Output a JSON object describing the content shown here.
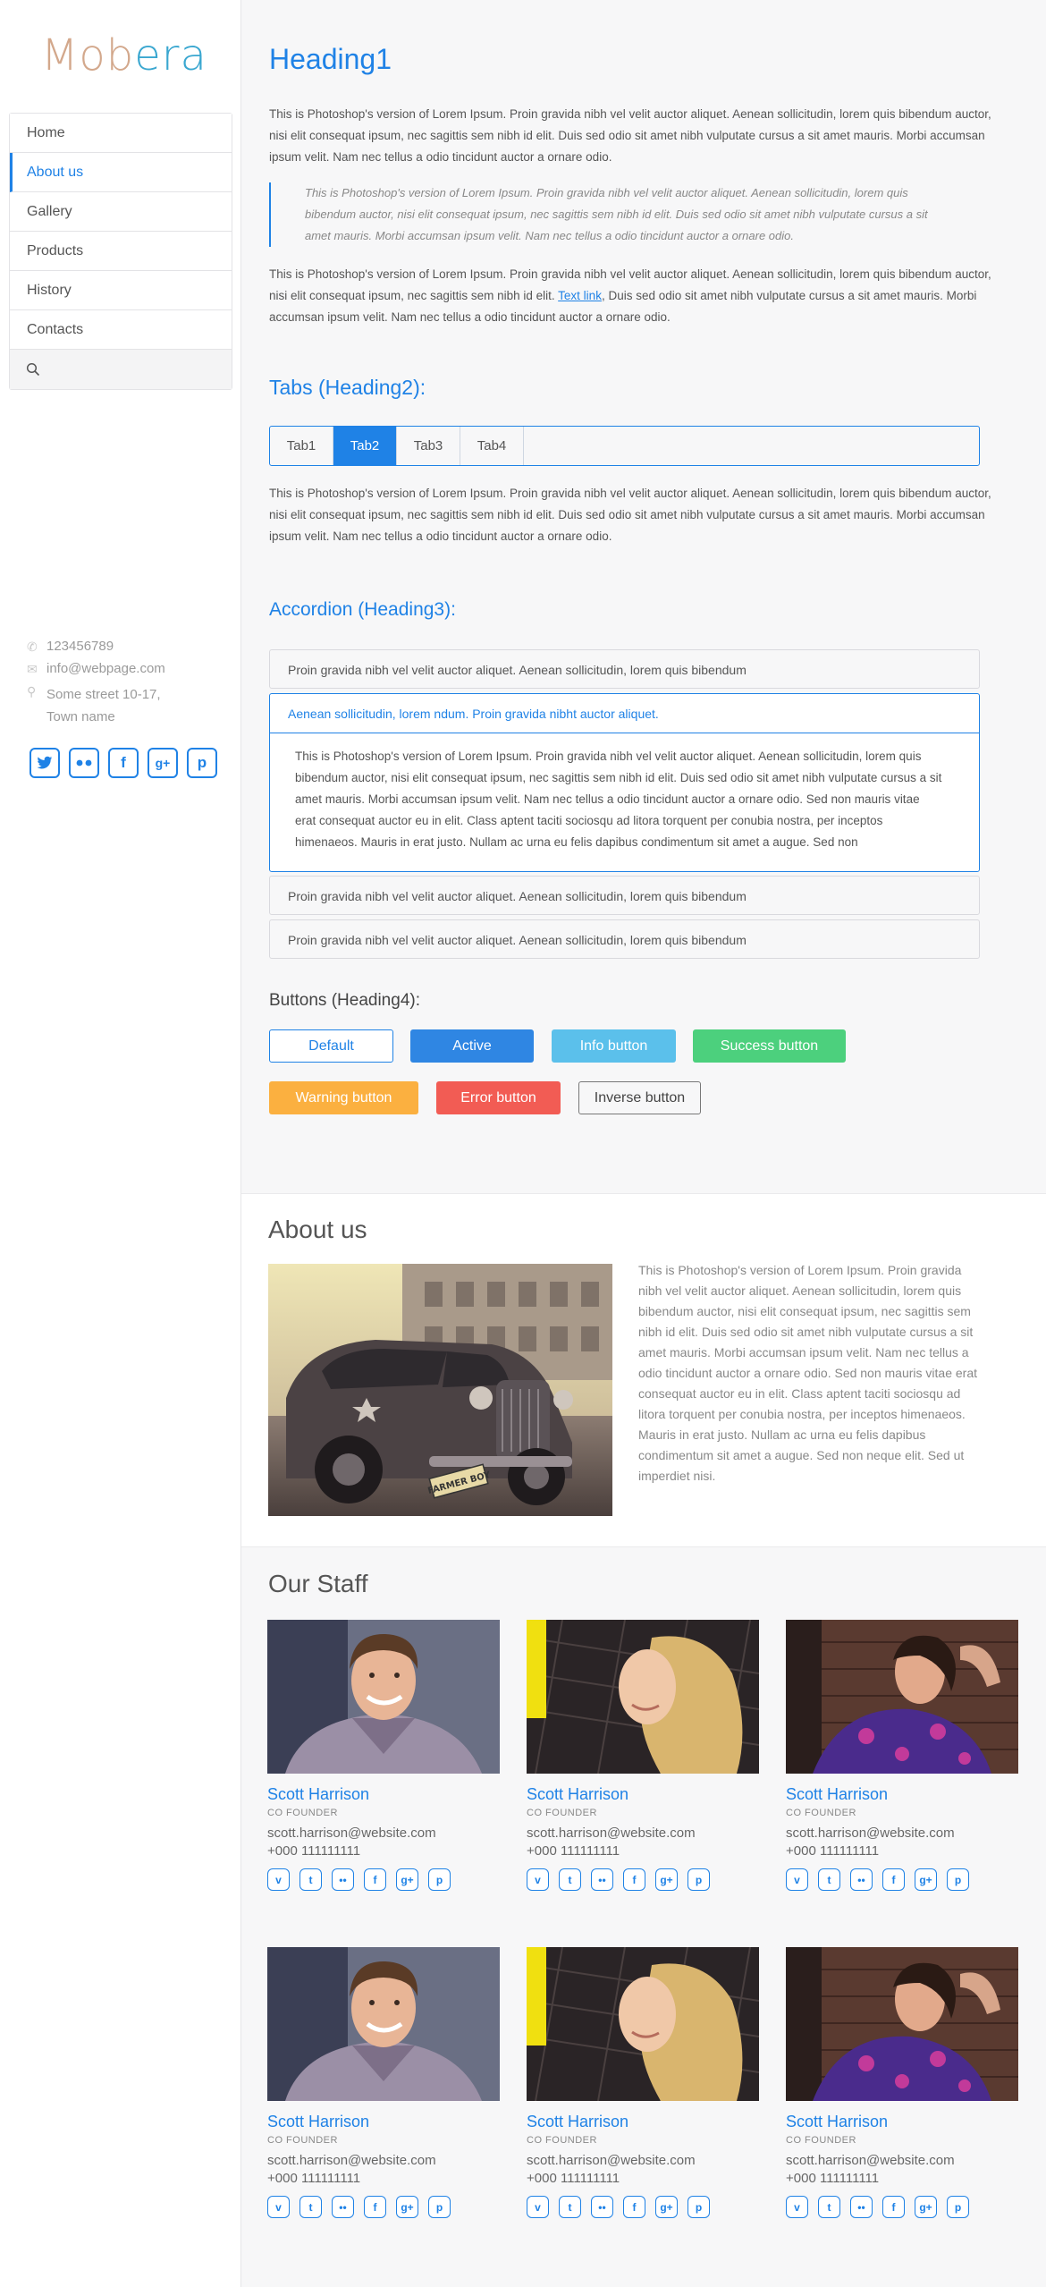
{
  "logo": {
    "part1": "Mob",
    "part2": "era"
  },
  "nav": {
    "items": [
      {
        "label": "Home"
      },
      {
        "label": "About us"
      },
      {
        "label": "Gallery"
      },
      {
        "label": "Products"
      },
      {
        "label": "History"
      },
      {
        "label": "Contacts"
      }
    ],
    "active": "About us",
    "search_icon": "search-icon"
  },
  "contact": {
    "phone": "123456789",
    "email": "info@webpage.com",
    "address_line1": "Some street 10-17,",
    "address_line2": "Town name"
  },
  "sidebar_socials": [
    "twitter",
    "flickr",
    "facebook",
    "google-plus",
    "pinterest"
  ],
  "main": {
    "heading1": "Heading1",
    "para1": "This is Photoshop's version  of Lorem Ipsum. Proin gravida nibh vel velit auctor aliquet. Aenean sollicitudin, lorem quis bibendum auctor, nisi elit consequat ipsum, nec sagittis sem nibh id elit. Duis sed odio sit amet nibh vulputate cursus a sit amet mauris. Morbi accumsan ipsum velit. Nam nec tellus a odio tincidunt auctor a ornare odio.",
    "quote": "This is Photoshop's version  of Lorem Ipsum. Proin gravida nibh vel velit auctor aliquet. Aenean sollicitudin, lorem quis bibendum auctor, nisi elit consequat ipsum, nec sagittis sem nibh id elit. Duis sed odio sit amet nibh vulputate cursus a sit amet mauris. Morbi accumsan ipsum velit. Nam nec tellus a odio tincidunt auctor a ornare odio.",
    "para2_before": "This is Photoshop's version  of Lorem Ipsum. Proin gravida nibh vel velit auctor aliquet. Aenean sollicitudin, lorem quis bibendum auctor, nisi elit consequat ipsum, nec sagittis sem nibh id elit. ",
    "para2_link": "Text link",
    "para2_after": ", Duis sed odio sit amet nibh vulputate cursus a sit amet mauris. Morbi accumsan ipsum velit. Nam nec tellus a odio tincidunt auctor a ornare odio.",
    "heading2": "Tabs (Heading2):",
    "tabs": [
      "Tab1",
      "Tab2",
      "Tab3",
      "Tab4"
    ],
    "active_tab": "Tab2",
    "tab_text": "This is Photoshop's version  of Lorem Ipsum. Proin gravida nibh vel velit auctor aliquet. Aenean sollicitudin, lorem quis bibendum auctor, nisi elit consequat ipsum, nec sagittis sem nibh id elit. Duis sed odio sit amet nibh vulputate cursus a sit amet mauris. Morbi accumsan ipsum velit. Nam nec tellus a odio tincidunt auctor a ornare odio.",
    "heading3": "Accordion (Heading3):",
    "accordion": {
      "item1": "Proin gravida nibh vel velit auctor aliquet. Aenean sollicitudin, lorem quis bibendum",
      "open_title": "Aenean sollicitudin, lorem ndum. Proin gravida nibht auctor aliquet.",
      "open_body": "This is Photoshop's version  of Lorem Ipsum. Proin gravida nibh vel velit auctor aliquet. Aenean sollicitudin, lorem quis bibendum auctor, nisi elit consequat ipsum, nec sagittis sem nibh id elit. Duis sed odio sit amet nibh vulputate cursus a sit amet mauris. Morbi accumsan ipsum velit. Nam nec tellus a odio tincidunt auctor a ornare odio. Sed non  mauris vitae erat consequat auctor eu in elit. Class aptent taciti sociosqu ad litora torquent per conubia nostra, per inceptos himenaeos. Mauris in erat justo. Nullam ac urna eu felis dapibus condimentum sit amet a augue. Sed non",
      "item3": "Proin gravida nibh vel velit auctor aliquet. Aenean sollicitudin, lorem quis bibendum",
      "item4": "Proin gravida nibh vel velit auctor aliquet. Aenean sollicitudin, lorem quis bibendum"
    },
    "heading4": "Buttons (Heading4):",
    "buttons": {
      "default": "Default",
      "active": "Active",
      "info": "Info button",
      "success": "Success button",
      "warning": "Warning button",
      "error": "Error button",
      "inverse": "Inverse button"
    }
  },
  "about": {
    "title": "About us",
    "text": "This is Photoshop's version  of Lorem Ipsum. Proin gravida nibh vel velit auctor aliquet. Aenean sollicitudin, lorem quis bibendum auctor, nisi elit consequat ipsum, nec sagittis sem nibh id elit. Duis sed odio sit amet nibh vulputate cursus a sit amet mauris. Morbi accumsan ipsum velit. Nam nec tellus a odio tincidunt auctor a ornare odio. Sed non  mauris vitae erat consequat auctor eu in elit. Class aptent taciti sociosqu ad litora torquent per conubia nostra, per inceptos himenaeos. Mauris in erat justo. Nullam ac urna eu felis dapibus condimentum sit amet a augue. Sed non neque elit. Sed ut imperdiet nisi.",
    "plate": "FARMER BOY"
  },
  "staff": {
    "title": "Our Staff",
    "members": [
      {
        "name": "Scott Harrison",
        "role": "CO FOUNDER",
        "email": "scott.harrison@website.com",
        "phone": "+000 111111111"
      },
      {
        "name": "Scott Harrison",
        "role": "CO FOUNDER",
        "email": "scott.harrison@website.com",
        "phone": "+000 111111111"
      },
      {
        "name": "Scott Harrison",
        "role": "CO FOUNDER",
        "email": "scott.harrison@website.com",
        "phone": "+000 111111111"
      },
      {
        "name": "Scott Harrison",
        "role": "CO FOUNDER",
        "email": "scott.harrison@website.com",
        "phone": "+000 111111111"
      },
      {
        "name": "Scott Harrison",
        "role": "CO FOUNDER",
        "email": "scott.harrison@website.com",
        "phone": "+000 111111111"
      },
      {
        "name": "Scott Harrison",
        "role": "CO FOUNDER",
        "email": "scott.harrison@website.com",
        "phone": "+000 111111111"
      }
    ],
    "social_icons": [
      "vimeo",
      "twitter",
      "flickr",
      "facebook",
      "google-plus",
      "pinterest"
    ]
  },
  "colors": {
    "accent": "#1f82e6",
    "info": "#5bc0eb",
    "success": "#4cd07d",
    "warning": "#fbb040",
    "error": "#f25c54"
  }
}
